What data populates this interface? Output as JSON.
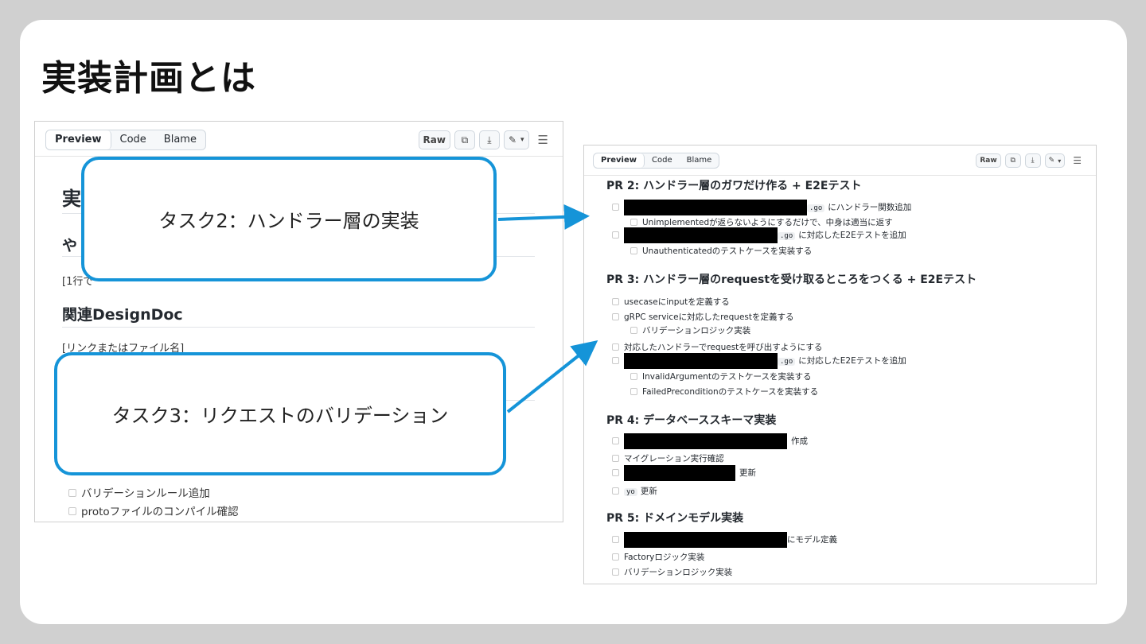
{
  "slide": {
    "title": "実装計画とは"
  },
  "panelA": {
    "tabs": {
      "preview": "Preview",
      "code": "Code",
      "blame": "Blame"
    },
    "raw_label": "Raw",
    "h1_partial": "実",
    "h2_partial": "や",
    "line_partial": "[1行で",
    "related_heading": "関連DesignDoc",
    "related_text": "[リンクまたはファイル名]",
    "bottom_items": [
      "バリデーションルール追加",
      "protoファイルのコンパイル確認"
    ]
  },
  "panelB": {
    "tabs": {
      "preview": "Preview",
      "code": "Code",
      "blame": "Blame"
    },
    "raw_label": "Raw",
    "pr2": {
      "heading": "PR 2: ハンドラー層のガワだけ作る + E2Eテスト",
      "i1_code": ".go",
      "i1_text": "にハンドラー関数追加",
      "i1_sub": "Unimplementedが返らないようにするだけで、中身は適当に返す",
      "i2_code": ".go",
      "i2_text": "に対応したE2Eテストを追加",
      "i2_sub": "Unauthenticatedのテストケースを実装する"
    },
    "pr3": {
      "heading": "PR 3: ハンドラー層のrequestを受け取るところをつくる + E2Eテスト",
      "i1": "usecaseにinputを定義する",
      "i2": "gRPC serviceに対応したrequestを定義する",
      "i2_sub": "バリデーションロジック実装",
      "i3": "対応したハンドラーでrequestを呼び出すようにする",
      "i4_code": ".go",
      "i4_text": "に対応したE2Eテストを追加",
      "i4_sub1": "InvalidArgumentのテストケースを実装する",
      "i4_sub2": "FailedPreconditionのテストケースを実装する"
    },
    "pr4": {
      "heading": "PR 4: データベーススキーマ実装",
      "i1_text": "作成",
      "i2": "マイグレーション実行確認",
      "i3_text": "更新",
      "i4_code": "yo",
      "i4_text": "更新"
    },
    "pr5": {
      "heading": "PR 5: ドメインモデル実装",
      "i1_text": "にモデル定義",
      "i2": "Factoryロジック実装",
      "i3": "バリデーションロジック実装"
    }
  },
  "callouts": {
    "task2": "タスク2：ハンドラー層の実装",
    "task3": "タスク3：リクエストのバリデーション"
  },
  "icons": {
    "copy": "copy-icon",
    "download": "download-icon",
    "edit": "pencil-icon",
    "dropdown": "chevron-down-icon",
    "outline": "list-icon",
    "arrow": "arrow-icon"
  },
  "colors": {
    "accent": "#1594d8",
    "redaction": "#000000"
  }
}
